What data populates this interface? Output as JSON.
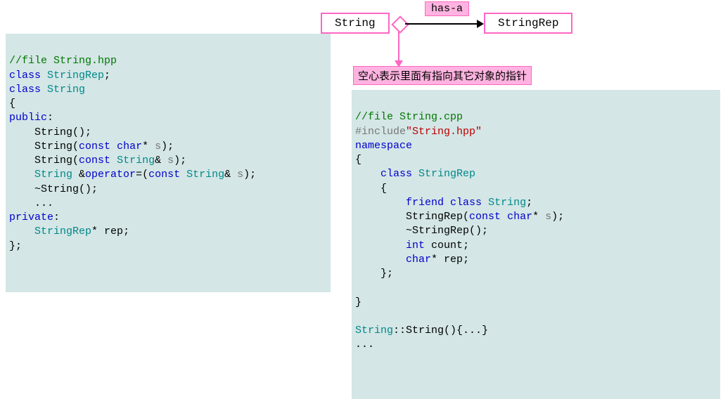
{
  "uml": {
    "left_box": "String",
    "right_box": "StringRep",
    "relation_label": "has-a",
    "note": "空心表示里面有指向其它对象的指针"
  },
  "left": {
    "comment": "//file String.hpp",
    "l2a": "class",
    "l2b": "StringRep",
    "l3a": "class",
    "l3b": "String",
    "l4": "{",
    "l5": "public",
    "l6": "String",
    "l7a": "String",
    "l7b": "const",
    "l7c": "char",
    "l7d": "s",
    "l8a": "String",
    "l8b": "const",
    "l8c": "String",
    "l8d": "s",
    "l9a": "String",
    "l9b": "operator",
    "l9c": "const",
    "l9d": "String",
    "l9e": "s",
    "l10": "String",
    "l11": "...",
    "l12": "private",
    "l13a": "StringRep",
    "l13b": "rep",
    "l14": "};"
  },
  "right": {
    "comment": "//file String.cpp",
    "l2a": "#include",
    "l2b": "\"String.hpp\"",
    "l3": "namespace",
    "l4": "{",
    "l5a": "class",
    "l5b": "StringRep",
    "l6": "{",
    "l7a": "friend",
    "l7b": "class",
    "l7c": "String",
    "l8a": "StringRep",
    "l8b": "const",
    "l8c": "char",
    "l8d": "s",
    "l9": "StringRep",
    "l10a": "int",
    "l10b": "count",
    "l11a": "char",
    "l11b": "rep",
    "l12": "};",
    "l13": "}",
    "l14a": "String",
    "l14b": "String",
    "l15": "..."
  }
}
